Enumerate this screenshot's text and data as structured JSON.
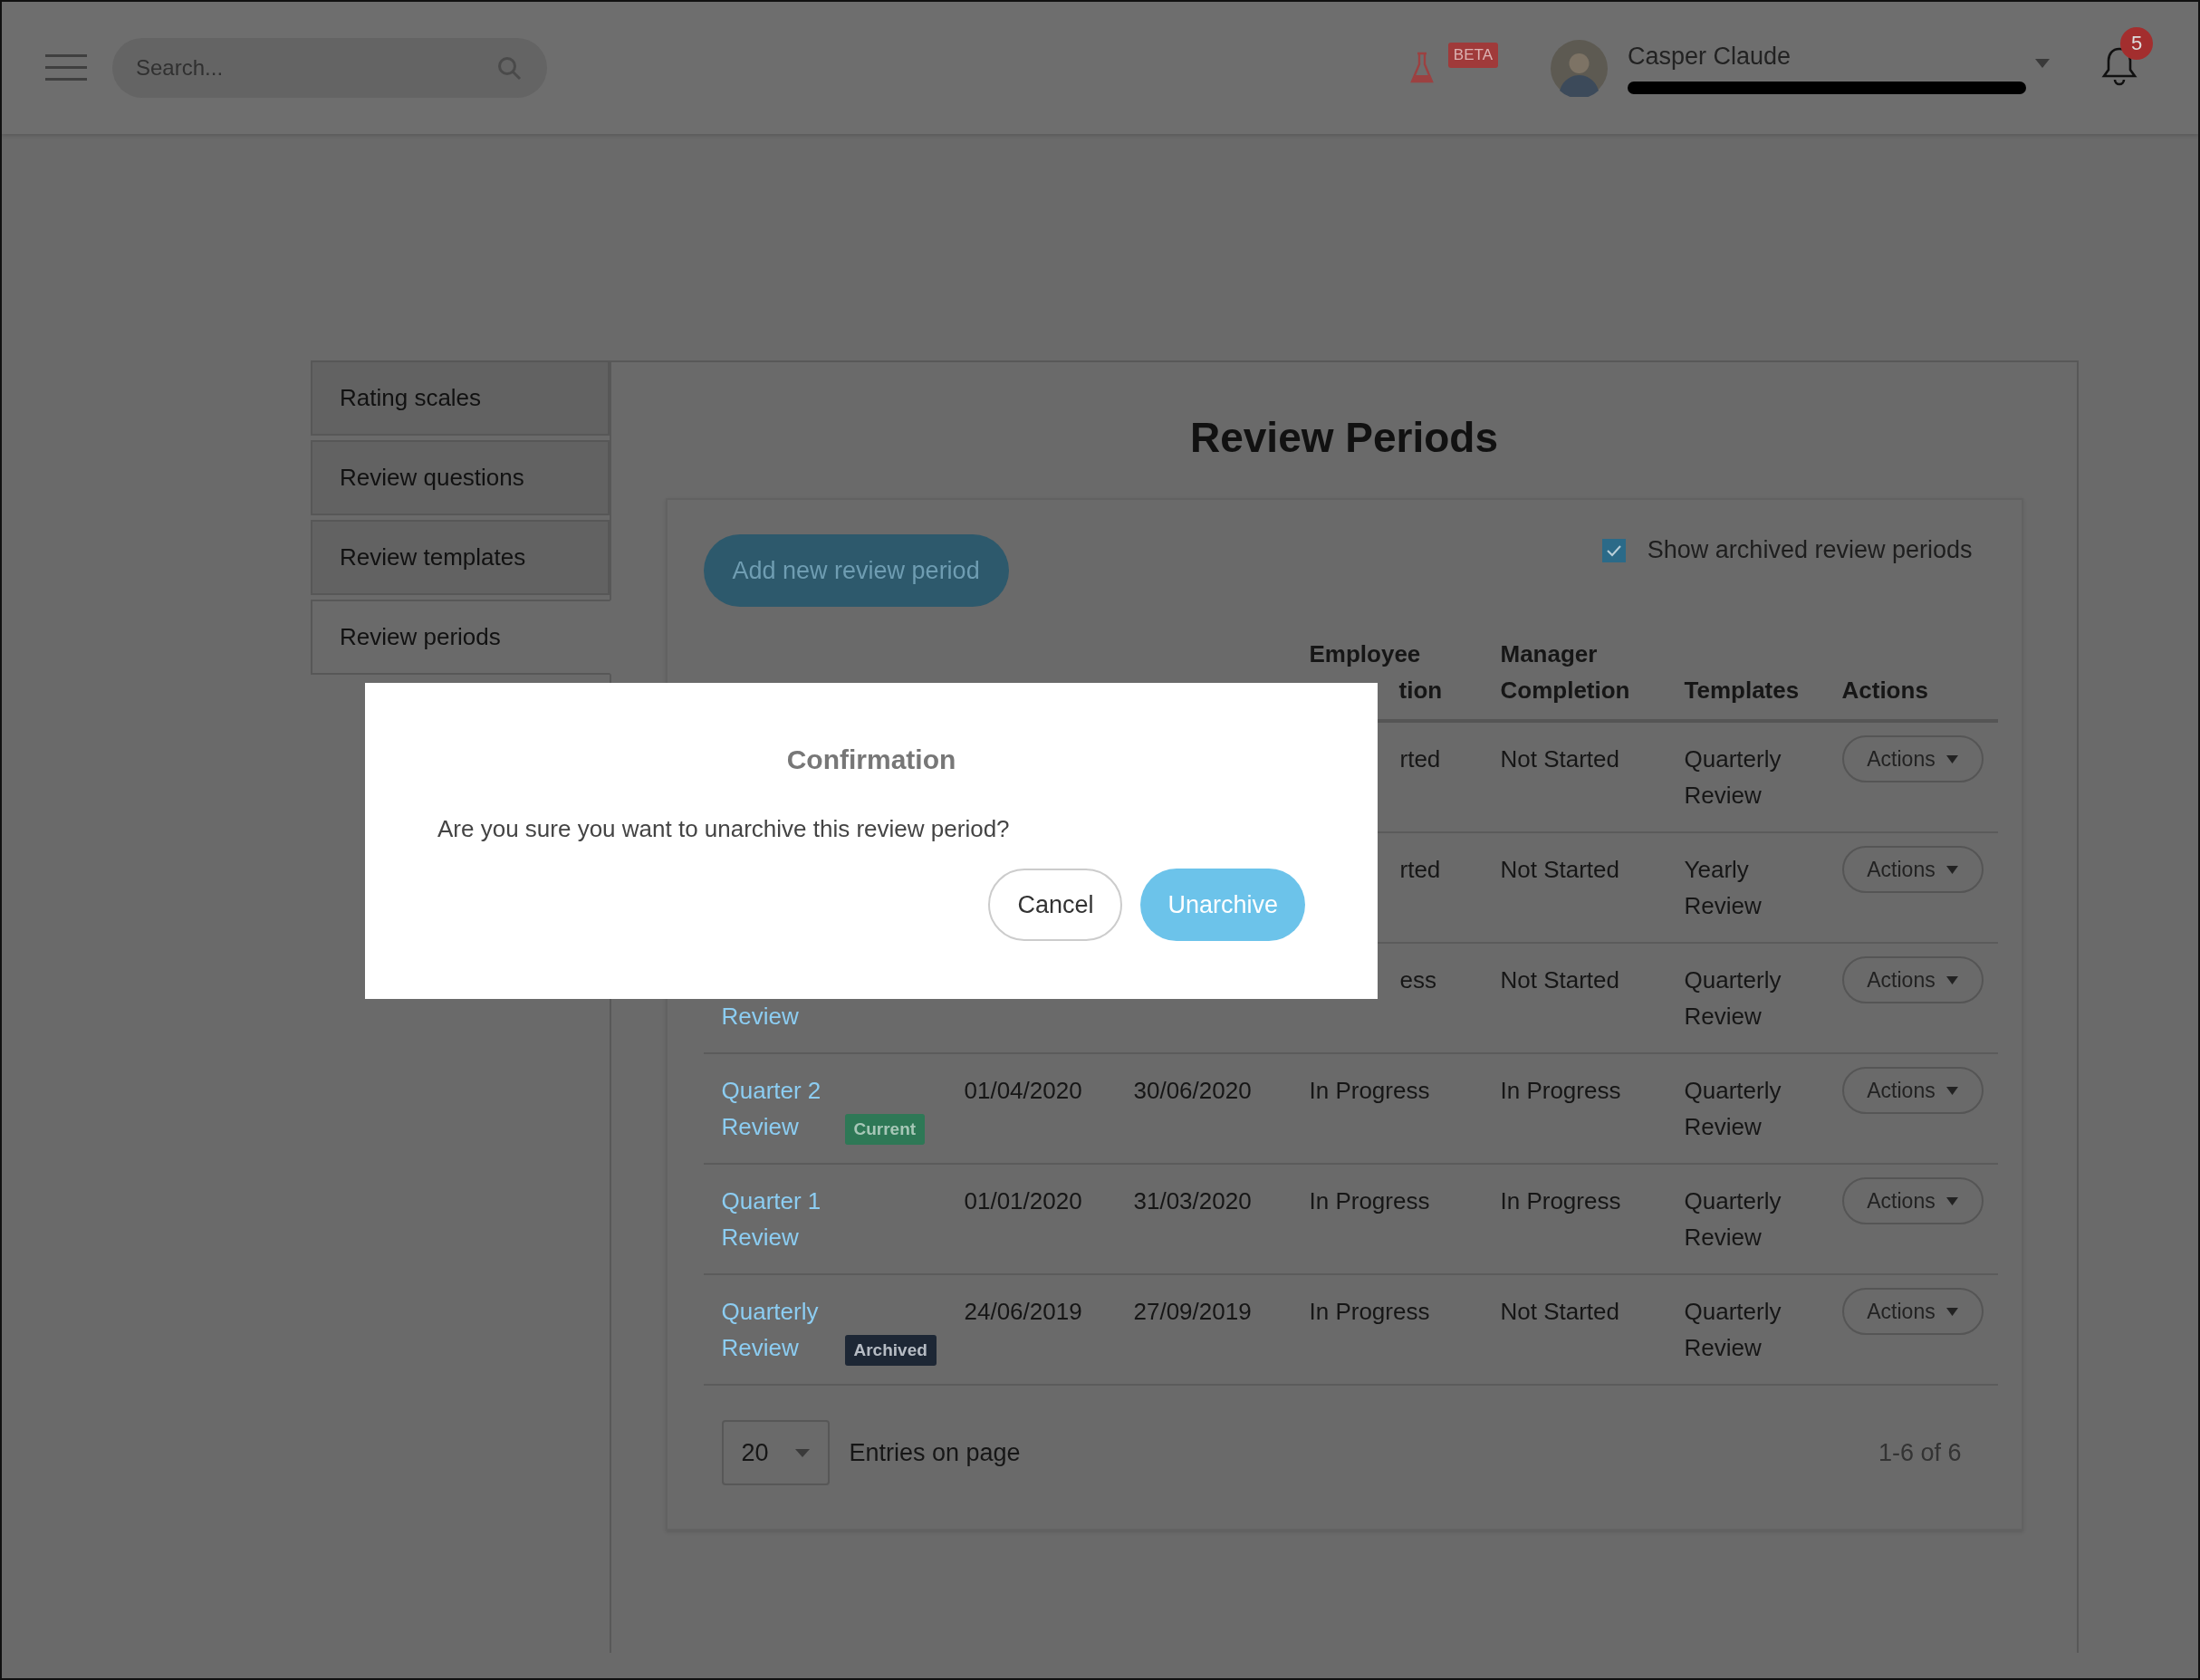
{
  "topbar": {
    "search": {
      "placeholder": "Search..."
    },
    "beta_badge": "BETA",
    "user": {
      "name": "Casper Claude"
    },
    "notification_count": "5"
  },
  "sidebar": {
    "items": [
      {
        "label": "Rating scales",
        "selected": false
      },
      {
        "label": "Review questions",
        "selected": false
      },
      {
        "label": "Review templates",
        "selected": false
      },
      {
        "label": "Review periods",
        "selected": true
      }
    ]
  },
  "page": {
    "title": "Review Periods",
    "add_button": "Add new review period",
    "show_archived": {
      "label": "Show archived review periods",
      "checked": true
    }
  },
  "table": {
    "headers": [
      {
        "label": "Employee",
        "covered_tail": "tion"
      },
      {
        "label": "Manager Completion"
      },
      {
        "label": "Templates"
      },
      {
        "label": "Actions"
      }
    ],
    "rows": [
      {
        "covered": true,
        "employee": "rted",
        "manager": "Not Started",
        "template": "Quarterly Review",
        "action": "Actions"
      },
      {
        "covered": true,
        "employee": "rted",
        "manager": "Not Started",
        "template": "Yearly Review",
        "action": "Actions"
      },
      {
        "covered": true,
        "title_tail": "Review",
        "employee": "ess",
        "manager": "Not Started",
        "template": "Quarterly Review",
        "action": "Actions"
      },
      {
        "covered": false,
        "title": "Quarter 2 Review",
        "badge": {
          "kind": "current",
          "label": "Current"
        },
        "start": "01/04/2020",
        "end": "30/06/2020",
        "employee": "In Progress",
        "manager": "In Progress",
        "template": "Quarterly Review",
        "action": "Actions"
      },
      {
        "covered": false,
        "title": "Quarter 1 Review",
        "start": "01/01/2020",
        "end": "31/03/2020",
        "employee": "In Progress",
        "manager": "In Progress",
        "template": "Quarterly Review",
        "action": "Actions"
      },
      {
        "covered": false,
        "title": "Quarterly Review",
        "badge": {
          "kind": "archived",
          "label": "Archived"
        },
        "start": "24/06/2019",
        "end": "27/09/2019",
        "employee": "In Progress",
        "manager": "Not Started",
        "template": "Quarterly Review",
        "action": "Actions"
      }
    ],
    "page_size": "20",
    "entries_label": "Entries on page",
    "range": "1-6 of 6"
  },
  "modal": {
    "title": "Confirmation",
    "message": "Are you sure you want to unarchive this review period?",
    "buttons": [
      {
        "label": "Cancel",
        "kind": "secondary"
      },
      {
        "label": "Unarchive",
        "kind": "primary"
      }
    ]
  }
}
